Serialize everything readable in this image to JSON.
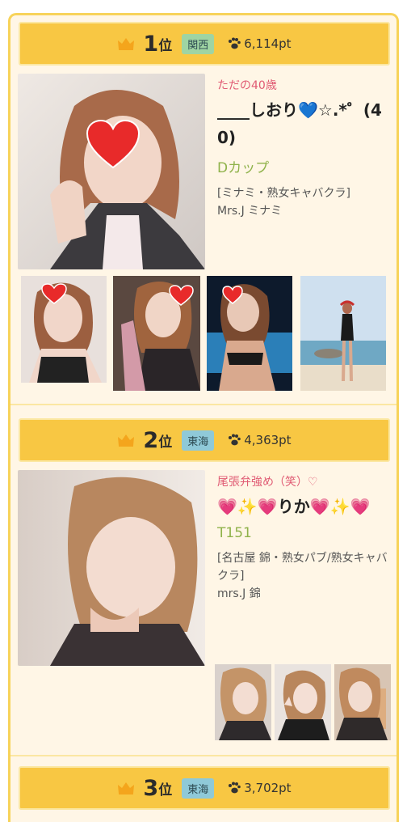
{
  "colors": {
    "panel_bg": "#fff6e6",
    "panel_border": "#f7d35a",
    "rank_bar": "#f8c743",
    "tagline": "#e05a73",
    "cup": "#8fb24a",
    "region_kansai": "#9fd4a3",
    "region_tokai": "#8fc9d8"
  },
  "rankings": [
    {
      "rank": "1",
      "suffix": "位",
      "region": "関西",
      "points": "6,114pt",
      "tagline": "ただの40歳",
      "name": "____しおり💙☆.*゜(40)",
      "cup": "Dカップ",
      "shop": "[ミナミ・熟女キャバクラ]",
      "store": "Mrs.J ミナミ",
      "icons": [
        "crown-icon",
        "paw-icon",
        "heart-sticker"
      ]
    },
    {
      "rank": "2",
      "suffix": "位",
      "region": "東海",
      "points": "4,363pt",
      "tagline": "尾張弁強め（笑）♡",
      "name": "💗✨💗りか💗✨💗",
      "cup": "T151",
      "shop": "[名古屋 錦・熟女パブ/熟女キャバクラ]",
      "store": "mrs.J 錦",
      "icons": [
        "crown-icon",
        "paw-icon"
      ]
    },
    {
      "rank": "3",
      "suffix": "位",
      "region": "東海",
      "points": "3,702pt",
      "icons": [
        "crown-icon",
        "paw-icon"
      ]
    }
  ]
}
